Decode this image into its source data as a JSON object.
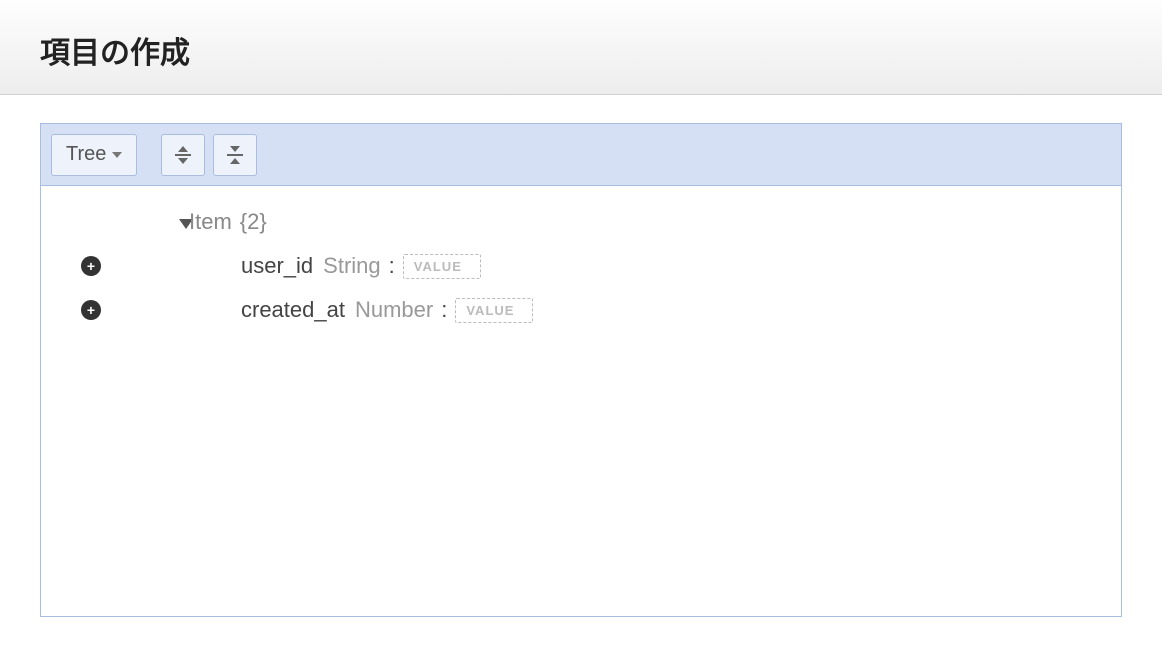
{
  "header": {
    "title": "項目の作成"
  },
  "toolbar": {
    "view_mode": "Tree"
  },
  "tree": {
    "root": {
      "label": "Item",
      "count_display": "{2}"
    },
    "fields": [
      {
        "name": "user_id",
        "type": "String",
        "value": "",
        "placeholder": "VALUE"
      },
      {
        "name": "created_at",
        "type": "Number",
        "value": "",
        "placeholder": "VALUE"
      }
    ]
  }
}
